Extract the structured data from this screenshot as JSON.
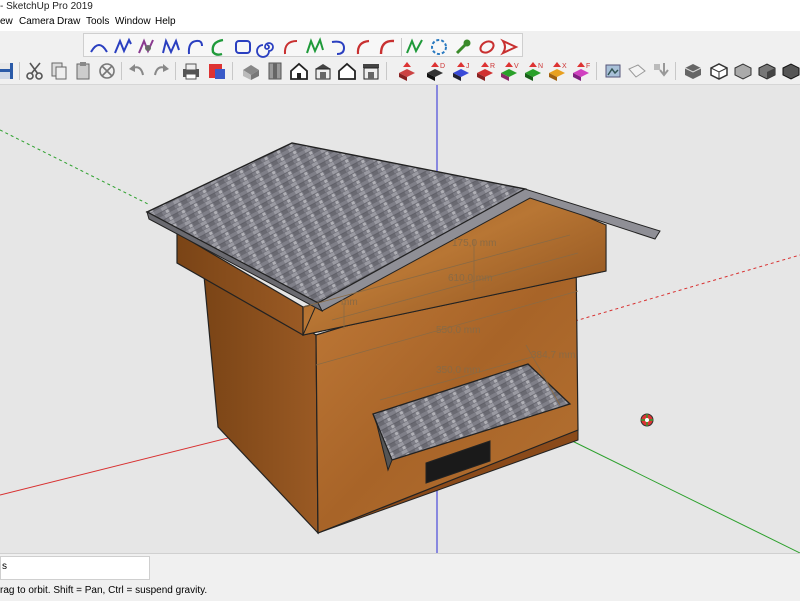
{
  "window": {
    "title": "- SketchUp Pro 2019"
  },
  "menu": {
    "items": [
      "ew",
      "Camera",
      "Draw",
      "Tools",
      "Window",
      "Help"
    ]
  },
  "dimensions": {
    "roof_height": "175,0 mm",
    "upper_width": "610,0 mm",
    "left_partial": "mm",
    "body_width": "550,0 mm",
    "side_depth": "384,7 mm",
    "entrance_width": "350,0 mm"
  },
  "status": {
    "tab_label": "s",
    "hint": "rag to orbit. Shift = Pan, Ctrl = suspend gravity."
  },
  "colors": {
    "background": "#e6e6e6",
    "axis_blue": "#2b2bd8",
    "axis_red": "#d83030",
    "axis_green": "#2ca02c",
    "wood": "#b06a2a",
    "roof": "#7d7d86"
  }
}
